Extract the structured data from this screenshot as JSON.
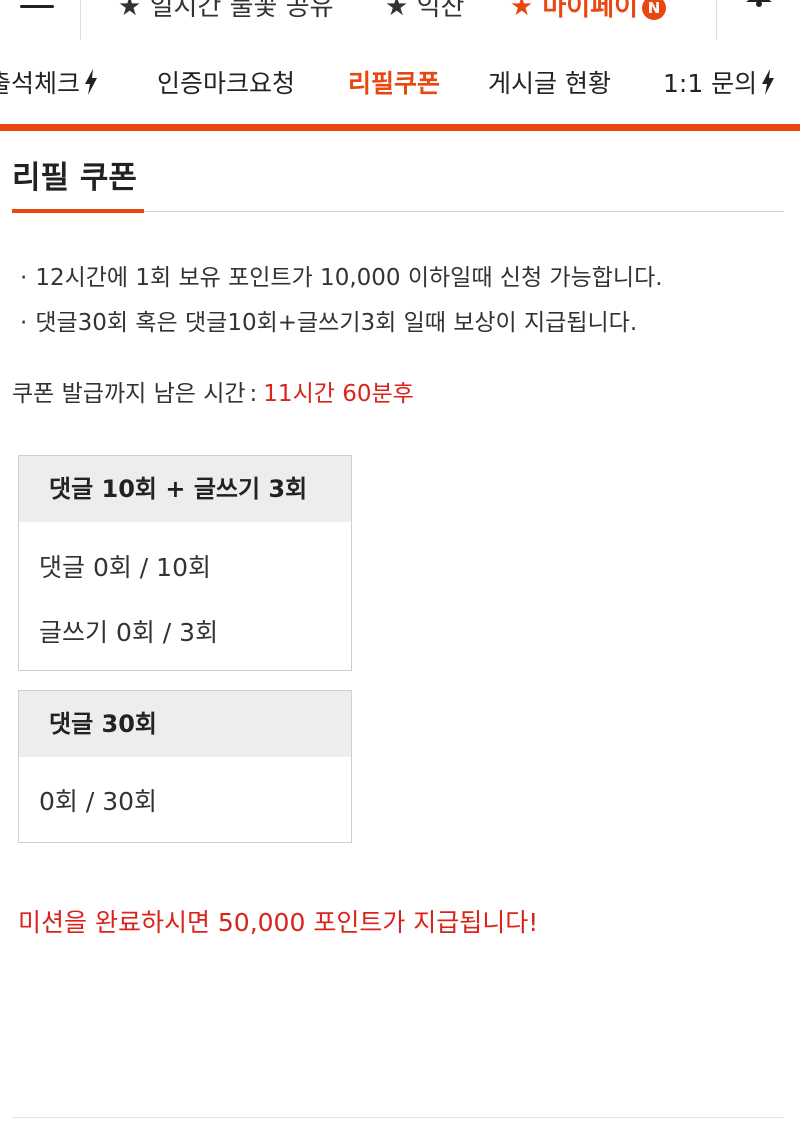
{
  "topbar": {
    "items": [
      {
        "label": "★ 일시간 불꽃 공유"
      },
      {
        "label": "★ 익찬"
      },
      {
        "label": "★ 마이페이"
      }
    ],
    "badge": "N"
  },
  "subnav": {
    "items": [
      {
        "label": "출석체크",
        "active": false,
        "bolt": true
      },
      {
        "label": "인증마크요청",
        "active": false,
        "bolt": false
      },
      {
        "label": "리필쿠폰",
        "active": true,
        "bolt": false
      },
      {
        "label": "게시글 현황",
        "active": false,
        "bolt": false
      },
      {
        "label": "1:1 문의",
        "active": false,
        "bolt": true
      }
    ]
  },
  "page": {
    "title": "리필 쿠폰",
    "notices": [
      "12시간에 1회 보유 포인트가 10,000 이하일때 신청 가능합니다.",
      "댓글30회 혹은 댓글10회+글쓰기3회 일때 보상이 지급됩니다."
    ],
    "bullet": "·",
    "timer_label": "쿠폰 발급까지 남은 시간",
    "timer_colon": ":",
    "timer_value": "11시간 60분후"
  },
  "missions": [
    {
      "title": "댓글 10회 + 글쓰기 3회",
      "rows": [
        "댓글 0회 / 10회",
        "글쓰기 0회 / 3회"
      ]
    },
    {
      "title": "댓글 30회",
      "rows": [
        "0회 / 30회"
      ]
    }
  ],
  "reward_text": "미션을 완료하시면 50,000 포인트가 지급됩니다!",
  "colors": {
    "accent": "#e8470f",
    "alert": "#d9231b",
    "box_header": "#ededed"
  }
}
